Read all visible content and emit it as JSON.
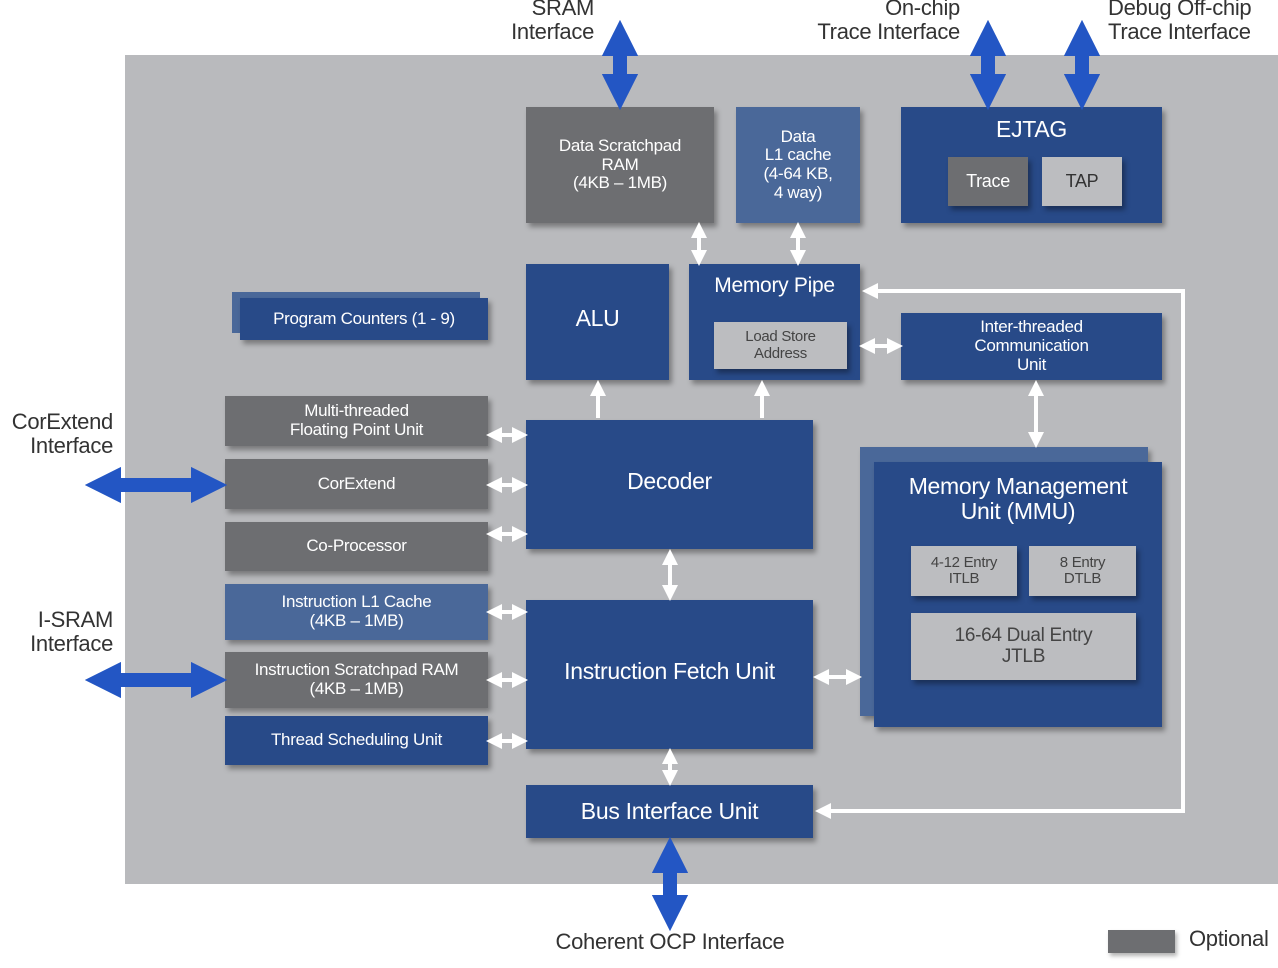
{
  "interfaces": {
    "sram": "SRAM\nInterface",
    "onchip_trace": "On-chip\nTrace Interface",
    "debug_offchip": "Debug Off-chip\nTrace Interface",
    "corextend": "CorExtend\nInterface",
    "isram": "I-SRAM\nInterface",
    "ocp": "Coherent OCP Interface"
  },
  "blocks": {
    "data_scratchpad": "Data Scratchpad\nRAM\n(4KB – 1MB)",
    "data_l1": "Data\nL1 cache\n(4-64 KB,\n4 way)",
    "ejtag": "EJTAG",
    "trace": "Trace",
    "tap": "TAP",
    "alu": "ALU",
    "memory_pipe": "Memory Pipe",
    "load_store": "Load Store\nAddress",
    "inter_threaded": "Inter-threaded\nCommunication\nUnit",
    "program_counters": "Program Counters (1 - 9)",
    "mt_fpu": "Multi-threaded\nFloating Point Unit",
    "corextend": "CorExtend",
    "coprocessor": "Co-Processor",
    "instr_l1": "Instruction L1 Cache\n(4KB – 1MB)",
    "instr_scratchpad": "Instruction Scratchpad RAM\n(4KB – 1MB)",
    "thread_scheduling": "Thread Scheduling Unit",
    "decoder": "Decoder",
    "ifu": "Instruction Fetch Unit",
    "biu": "Bus Interface Unit",
    "mmu": "Memory Management\nUnit (MMU)",
    "itlb": "4-12 Entry\nITLB",
    "dtlb": "8 Entry\nDTLB",
    "jtlb": "16-64 Dual Entry\nJTLB"
  },
  "legend": {
    "label": "Optional",
    "color": "#6d6e71"
  },
  "colors": {
    "dark_blue": "#284a88",
    "mid_blue": "#4a6899",
    "optional_gray": "#6d6e71",
    "light_gray": "#bcbdc0",
    "interface_arrow": "#2356c4",
    "panel": "#b9babd"
  }
}
